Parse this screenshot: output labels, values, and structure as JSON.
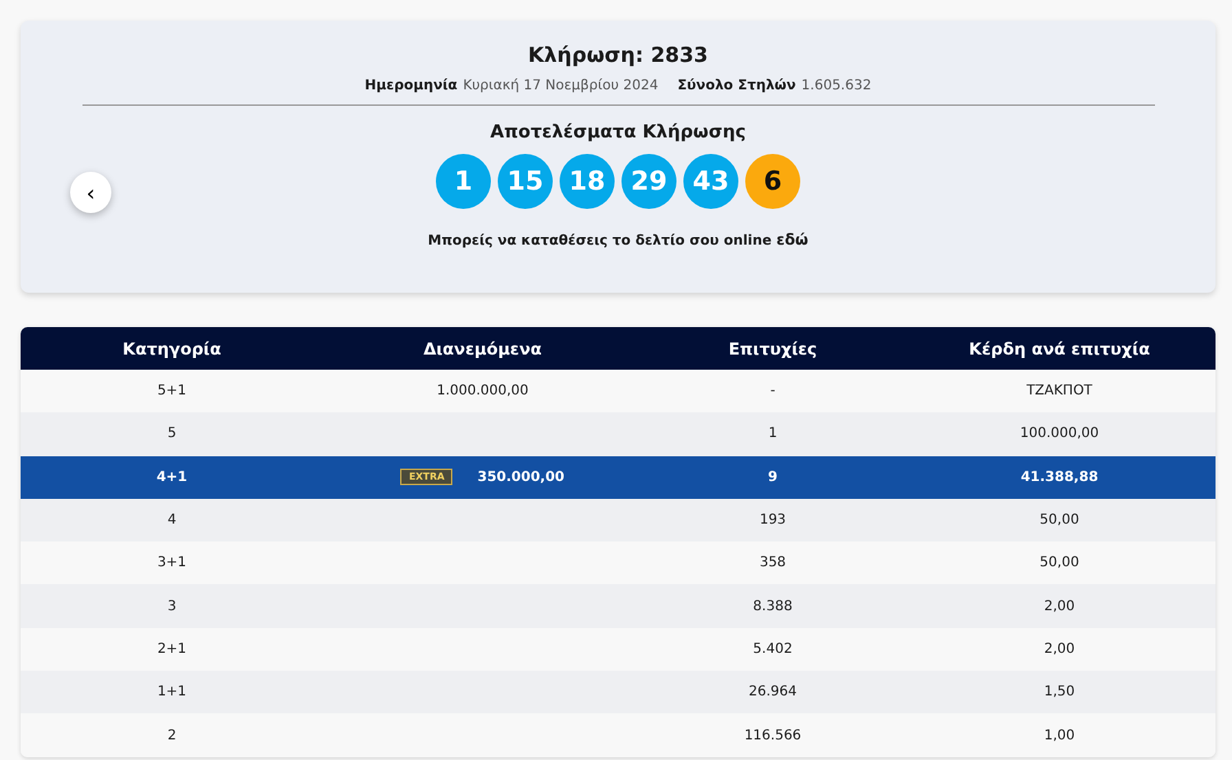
{
  "draw": {
    "title": "Κλήρωση: 2833",
    "date_label": "Ημερομηνία",
    "date": "Κυριακή 17 Νοεμβρίου 2024",
    "columns_label": "Σύνολο Στηλών",
    "columns": "1.605.632",
    "results_title": "Αποτελέσματα Κλήρωσης",
    "back_button": "‹",
    "balls": [
      {
        "number": "1",
        "kind": "main"
      },
      {
        "number": "15",
        "kind": "main"
      },
      {
        "number": "18",
        "kind": "main"
      },
      {
        "number": "29",
        "kind": "main"
      },
      {
        "number": "43",
        "kind": "main"
      },
      {
        "number": "6",
        "kind": "bonus"
      }
    ],
    "note": "Μπορείς να καταθέσεις το δελτίο σου online ",
    "note_link": "εδώ"
  },
  "table": {
    "columns": [
      "Κατηγορία",
      "Διανεμόμενα",
      "Επιτυχίες",
      "Κέρδη ανά επιτυχία"
    ],
    "rows": [
      {
        "cells": [
          "5+1",
          "1.000.000,00",
          "-",
          "ΤΖΑΚΠΟΤ"
        ],
        "selected": false
      },
      {
        "cells": [
          "5",
          "",
          "1",
          "100.000,00"
        ],
        "selected": false
      },
      {
        "cells": [
          "4+1",
          "350.000,00",
          "9",
          "41.388,88"
        ],
        "badge": "EXTRA",
        "selected": true
      },
      {
        "cells": [
          "4",
          "",
          "193",
          "50,00"
        ],
        "selected": false
      },
      {
        "cells": [
          "3+1",
          "",
          "358",
          "50,00"
        ],
        "selected": false
      },
      {
        "cells": [
          "3",
          "",
          "8.388",
          "2,00"
        ],
        "selected": false
      },
      {
        "cells": [
          "2+1",
          "",
          "5.402",
          "2,00"
        ],
        "selected": false
      },
      {
        "cells": [
          "1+1",
          "",
          "26.964",
          "1,50"
        ],
        "selected": false
      },
      {
        "cells": [
          "2",
          "",
          "116.566",
          "1,00"
        ],
        "selected": false
      }
    ]
  }
}
